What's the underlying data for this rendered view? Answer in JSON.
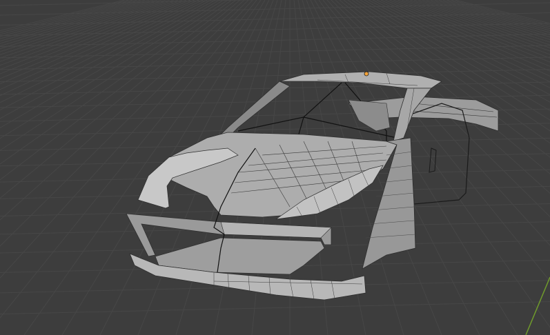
{
  "viewport": {
    "background": "#3d3d3d",
    "grid_color": "#444444",
    "axis_y_color": "#6f9a2c"
  },
  "object": {
    "name": "car-body-mesh",
    "surface_color": "#a3a3a3",
    "wire_color": "#2a2a2a",
    "origin_color": "#f2a33a"
  }
}
